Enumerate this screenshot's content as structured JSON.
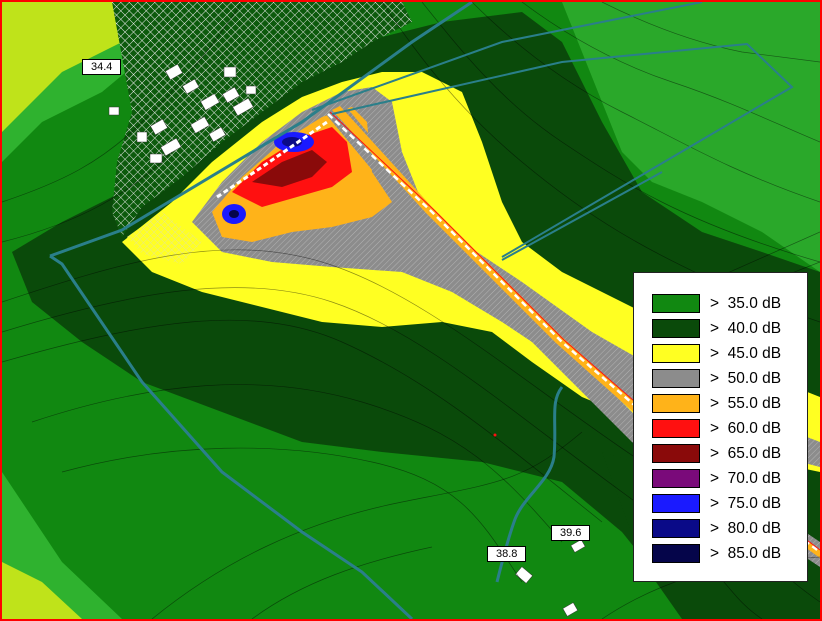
{
  "receiver_labels": [
    {
      "text": "34.4"
    },
    {
      "text": "39.6"
    },
    {
      "text": "38.8"
    }
  ],
  "legend": {
    "items": [
      {
        "label": ">  35.0 dB",
        "color": "#118811"
      },
      {
        "label": ">  40.0 dB",
        "color": "#0a4a0a"
      },
      {
        "label": ">  45.0 dB",
        "color": "#ffff22"
      },
      {
        "label": ">  50.0 dB",
        "color": "#8c8c8c"
      },
      {
        "label": ">  55.0 dB",
        "color": "#ffb319"
      },
      {
        "label": ">  60.0 dB",
        "color": "#ff1010"
      },
      {
        "label": ">  65.0 dB",
        "color": "#8a0a0a"
      },
      {
        "label": ">  70.0 dB",
        "color": "#7a0a7a"
      },
      {
        "label": ">  75.0 dB",
        "color": "#1a1aff"
      },
      {
        "label": ">  80.0 dB",
        "color": "#0a0a88"
      },
      {
        "label": ">  85.0 dB",
        "color": "#05054a"
      }
    ]
  },
  "colors": {
    "below_35": "#2fb22f",
    "outer_light": "#bfe31a",
    "boundary": "#2a7f8a",
    "frame": "#ff0000"
  }
}
